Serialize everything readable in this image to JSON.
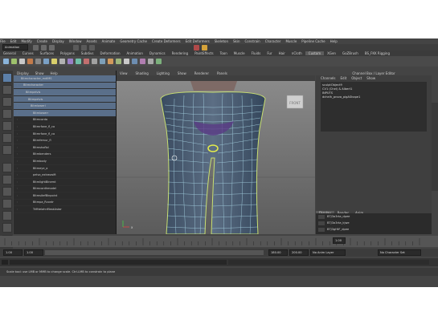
{
  "menubar": [
    "File",
    "Edit",
    "Modify",
    "Create",
    "Display",
    "Window",
    "Assets",
    "Animate",
    "Geometry Cache",
    "Create Deformers",
    "Edit Deformers",
    "Skeleton",
    "Skin",
    "Constrain",
    "Character",
    "Muscle",
    "Pipeline Cache",
    "Help"
  ],
  "mode_dropdown": "Animation",
  "shelf_tabs": [
    "General",
    "Curves",
    "Surfaces",
    "Polygons",
    "Subdivs",
    "Deformation",
    "Animation",
    "Dynamics",
    "Rendering",
    "PaintEffects",
    "Toon",
    "Muscle",
    "Fluids",
    "Fur",
    "Hair",
    "nCloth",
    "Custom",
    "XGen",
    "GoZBrush",
    "BS_FKK Rigging"
  ],
  "outliner": {
    "menu": [
      "Display",
      "Show",
      "Help"
    ],
    "rows": [
      {
        "label": "Bitmcharacter_mdlMS",
        "selected": true
      },
      {
        "label": "Bitmcharacter",
        "selected": true
      },
      {
        "label": "Bitmpelvis",
        "selected": true
      },
      {
        "label": "Bitmpelvis",
        "selected": true
      },
      {
        "label": "Bitmlowerl",
        "selected": true
      },
      {
        "label": "Bitmlowerr",
        "selected": true
      },
      {
        "label": "Bitmcorda",
        "selected": false
      },
      {
        "label": "Bitmrfone_fl_co",
        "selected": false
      },
      {
        "label": "Bitmrfone_fl_co",
        "selected": false
      },
      {
        "label": "Bitmfemur_fl",
        "selected": false
      },
      {
        "label": "Bitmshoflol",
        "selected": false
      },
      {
        "label": "Bitmbenders",
        "selected": false
      },
      {
        "label": "Bitmbody",
        "selected": false
      },
      {
        "label": "Bitmeye_a",
        "selected": false
      },
      {
        "label": "pelvo_extraswift",
        "selected": false
      },
      {
        "label": "BitmlightBinemt",
        "selected": false
      },
      {
        "label": "Bitmcordhmodel",
        "selected": false
      },
      {
        "label": "BitmsitefBinpoint",
        "selected": false
      },
      {
        "label": "Bitmpa_Rcontr",
        "selected": false
      },
      {
        "label": "TrifttelahnMaskAstar",
        "selected": false
      }
    ]
  },
  "viewport": {
    "menu": [
      "View",
      "Shading",
      "Lighting",
      "Show",
      "Renderer",
      "Panels"
    ],
    "cube_label": "FRONT",
    "axis_label": "x"
  },
  "channel_box": {
    "title": "Channel Box / Layer Editor",
    "tabs": [
      "Channels",
      "Edit",
      "Object",
      "Show"
    ],
    "lines": [
      "sculptObject9",
      "CV1 (Chel) & Albert1",
      "INPUTS",
      "dchelh_prova_pigAShape1"
    ],
    "layer_tabs": [
      "Display",
      "Render",
      "Anim"
    ],
    "layer_menu": [
      "Layers",
      "Options",
      "Help"
    ],
    "layers": [
      "BTJ3a3rta_dpee",
      "BTJ3a3rta_kjwe",
      "BTJ3gHtF_dpee",
      "BTJ3Sxrdk_fkes"
    ]
  },
  "timeline": {
    "start": "1.00",
    "end": "180.00",
    "current": "1.00",
    "range_start": "1.00",
    "range_end": "1.00",
    "range_mid": "180.00",
    "anim_end": "200.00",
    "anim_layer": "No Anim Layer",
    "char_set": "No Character Set"
  },
  "help_line": "Scale tool: use LMB or MMB to change scale. Ctrl-LMB to constrain to plane"
}
